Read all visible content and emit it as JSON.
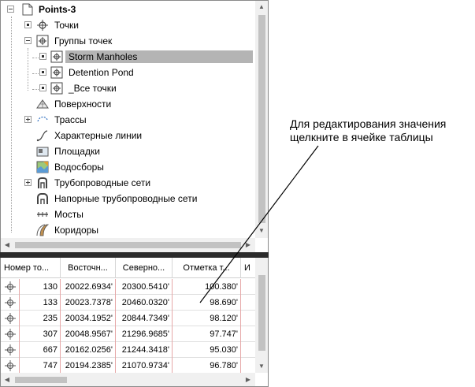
{
  "tree": {
    "root": "Points-3",
    "items": [
      {
        "label": "Точки",
        "icon": "point-icon"
      },
      {
        "label": "Группы точек",
        "icon": "point-group-icon"
      },
      {
        "label": "Storm Manholes",
        "icon": "point-group-icon"
      },
      {
        "label": "Detention Pond",
        "icon": "point-group-icon"
      },
      {
        "label": "_Все точки",
        "icon": "point-group-icon"
      },
      {
        "label": "Поверхности",
        "icon": "surface-icon"
      },
      {
        "label": "Трассы",
        "icon": "alignment-icon"
      },
      {
        "label": "Характерные линии",
        "icon": "feature-line-icon"
      },
      {
        "label": "Площадки",
        "icon": "site-icon"
      },
      {
        "label": "Водосборы",
        "icon": "catchment-icon"
      },
      {
        "label": "Трубопроводные сети",
        "icon": "pipe-network-icon"
      },
      {
        "label": "Напорные трубопроводные сети",
        "icon": "pressure-network-icon"
      },
      {
        "label": "Мосты",
        "icon": "bridge-icon"
      },
      {
        "label": "Коридоры",
        "icon": "corridor-icon"
      }
    ]
  },
  "grid": {
    "columns": [
      "Номер то...",
      "Восточн...",
      "Северно...",
      "Отметка т...",
      "И"
    ],
    "rows": [
      [
        "130",
        "20022.6934'",
        "20300.5410'",
        "100.380'"
      ],
      [
        "133",
        "20023.7378'",
        "20460.0320'",
        "98.690'"
      ],
      [
        "235",
        "20034.1952'",
        "20844.7349'",
        "98.120'"
      ],
      [
        "307",
        "20048.9567'",
        "21296.9685'",
        "97.747'"
      ],
      [
        "667",
        "20162.0256'",
        "21244.3418'",
        "95.030'"
      ],
      [
        "747",
        "20194.2385'",
        "21070.9734'",
        "96.780'"
      ]
    ]
  },
  "callout": {
    "line1": "Для редактирования значения",
    "line2": "щелкните в ячейке таблицы"
  }
}
